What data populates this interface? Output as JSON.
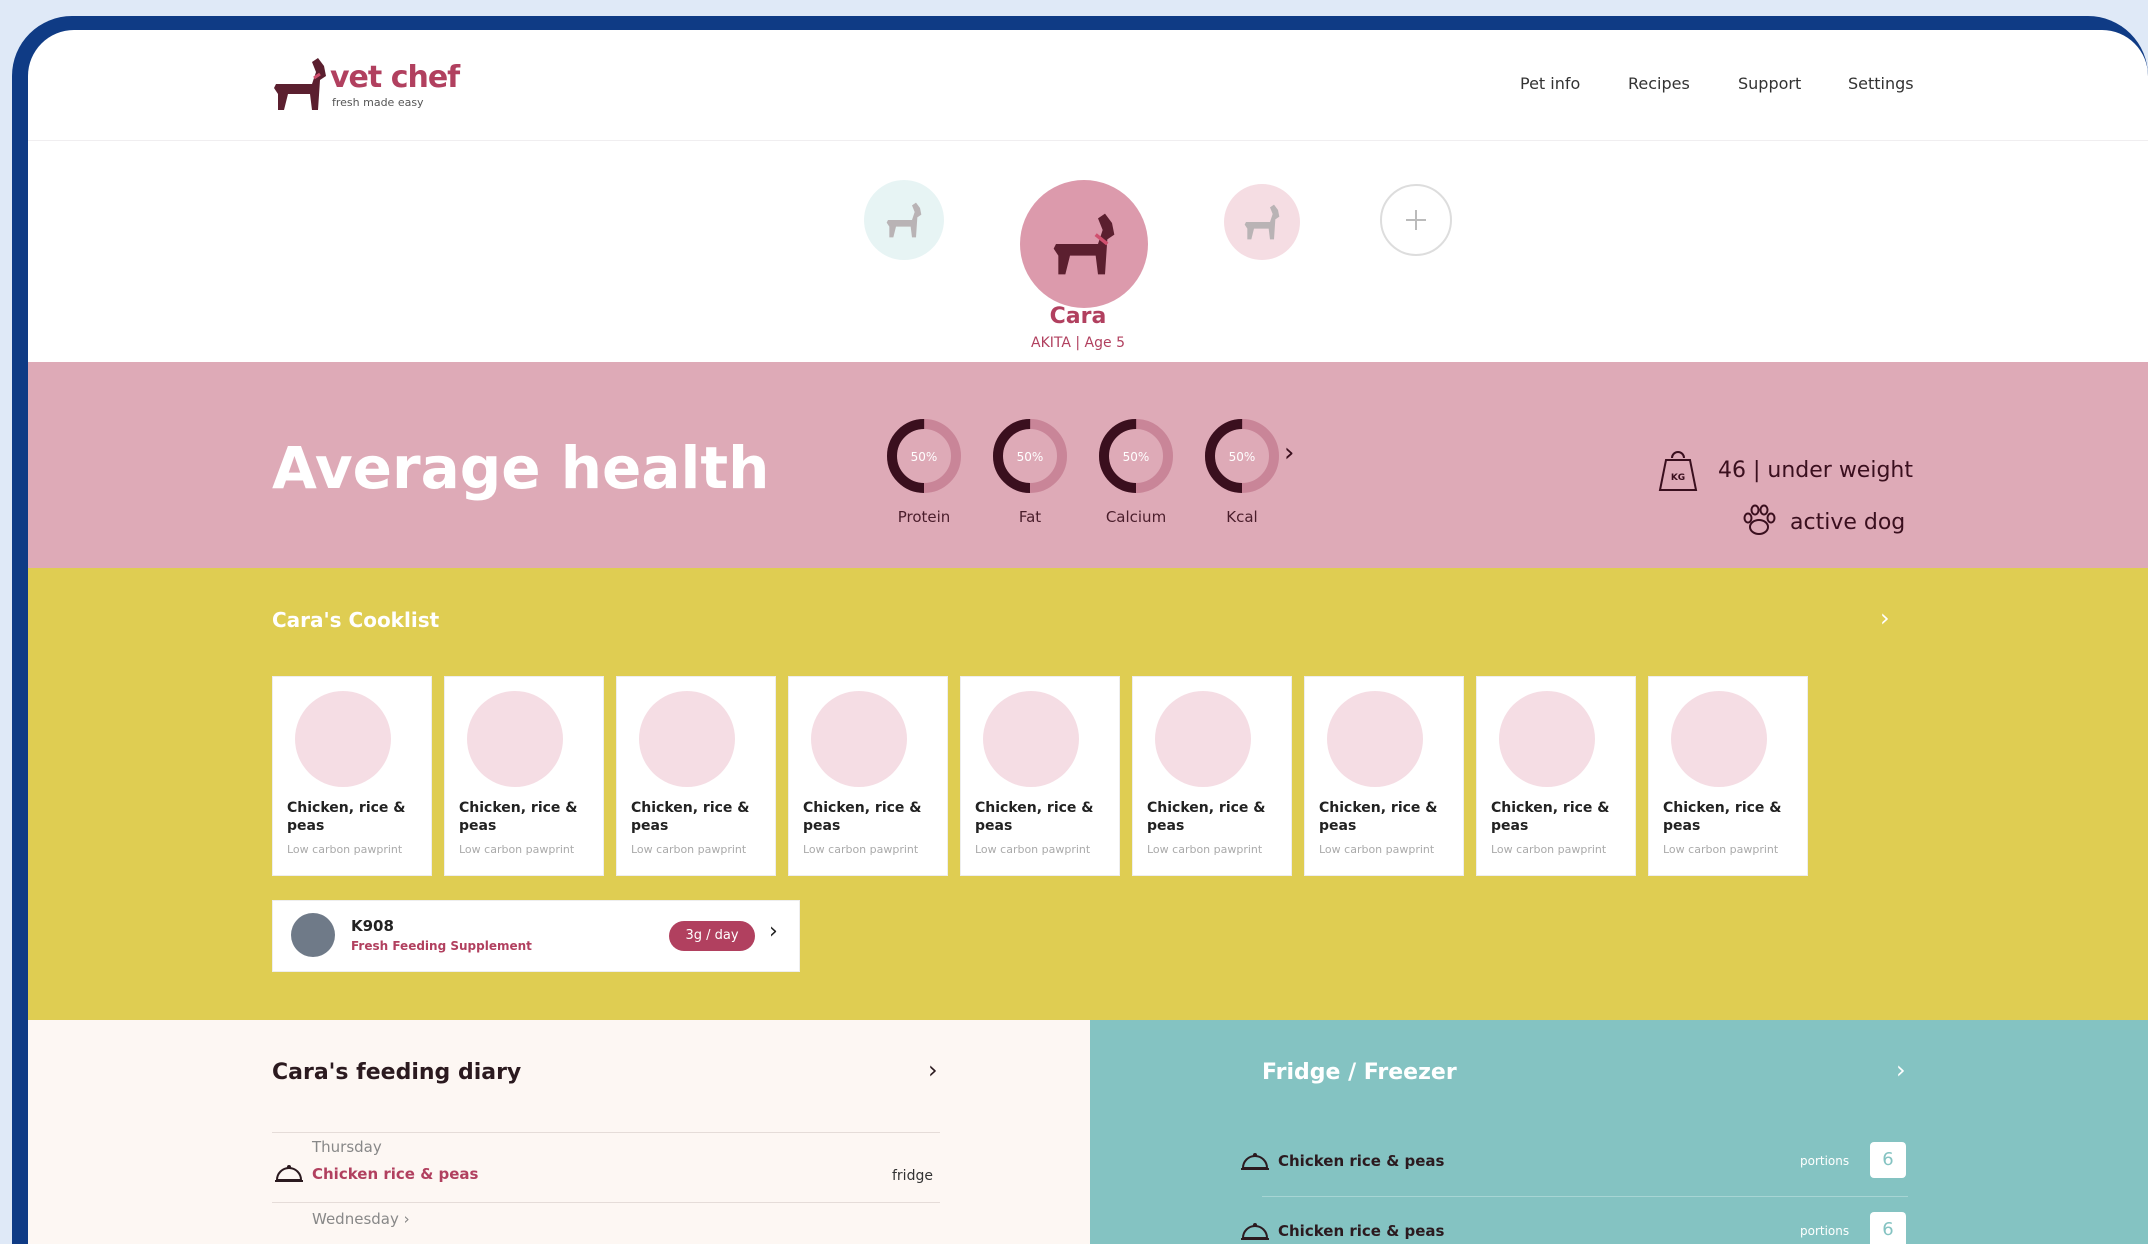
{
  "brand": {
    "name": "vet chef",
    "tagline": "fresh made easy"
  },
  "nav": [
    "Pet info",
    "Recipes",
    "Support",
    "Settings"
  ],
  "pet": {
    "name": "Cara",
    "breed_age": "AKITA | Age 5"
  },
  "health": {
    "title": "Average health",
    "gauges": [
      {
        "label": "Protein",
        "value": "50%",
        "level": 0.5
      },
      {
        "label": "Fat",
        "value": "50%",
        "level": 0.5
      },
      {
        "label": "Calcium",
        "value": "50%",
        "level": 0.5
      },
      {
        "label": "Kcal",
        "value": "50%",
        "level": 0.5
      }
    ],
    "weight_icon_text": "KG",
    "weight": "46 | under weight",
    "activity": "active dog"
  },
  "cooklist": {
    "title": "Cara's Cooklist",
    "cards": [
      {
        "name": "Chicken, rice & peas",
        "sub": "Low carbon pawprint"
      },
      {
        "name": "Chicken, rice & peas",
        "sub": "Low carbon pawprint"
      },
      {
        "name": "Chicken, rice & peas",
        "sub": "Low carbon pawprint"
      },
      {
        "name": "Chicken, rice & peas",
        "sub": "Low carbon pawprint"
      },
      {
        "name": "Chicken, rice & peas",
        "sub": "Low carbon pawprint"
      },
      {
        "name": "Chicken, rice & peas",
        "sub": "Low carbon pawprint"
      },
      {
        "name": "Chicken, rice & peas",
        "sub": "Low carbon pawprint"
      },
      {
        "name": "Chicken, rice & peas",
        "sub": "Low carbon pawprint"
      },
      {
        "name": "Chicken, rice & peas",
        "sub": "Low carbon pawprint"
      }
    ],
    "supplement": {
      "name": "K908",
      "sub": "Fresh Feeding Supplement",
      "dose": "3g / day"
    }
  },
  "diary": {
    "title": "Cara's feeding diary",
    "entries": [
      {
        "day": "Thursday",
        "meal": "Chicken rice & peas",
        "location": "fridge"
      },
      {
        "day": "Wednesday ›"
      }
    ]
  },
  "fridge": {
    "title": "Fridge / Freezer",
    "items": [
      {
        "name": "Chicken rice & peas",
        "label": "portions",
        "count": "6"
      },
      {
        "name": "Chicken rice & peas",
        "label": "portions",
        "count": "6"
      }
    ]
  },
  "colors": {
    "accent": "#b1405f",
    "health_band": "#deaab7",
    "cooklist_band": "#dfcd52",
    "fridge_band": "#84c3c2"
  }
}
